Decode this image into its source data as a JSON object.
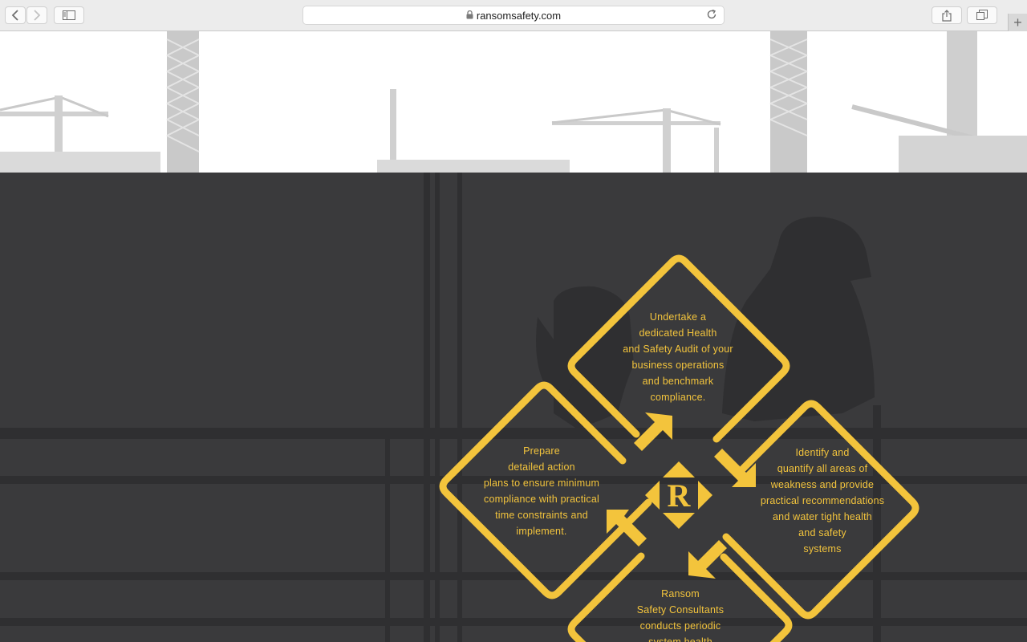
{
  "browser": {
    "url": "ransomsafety.com",
    "icons": {
      "back": "chevron-left-icon",
      "forward": "chevron-right-icon",
      "sidebar": "sidebar-icon",
      "lock": "lock-icon",
      "reload": "reload-icon",
      "share": "share-icon",
      "tabs": "tabs-icon",
      "new_tab": "plus-icon"
    }
  },
  "colors": {
    "accent": "#f3c43c",
    "dark_bg": "#3a3a3c",
    "silhouette": "#2f2f31",
    "hero_silhouette": "#cfcfcf"
  },
  "process": {
    "logo_letter": "R",
    "steps": [
      {
        "text": "Undertake a\ndedicated Health\nand Safety Audit of your\nbusiness operations\nand benchmark\ncompliance."
      },
      {
        "text": "Identify and\nquantify all areas of\nweakness and provide\npractical recommendations\nand water tight health\nand safety\nsystems"
      },
      {
        "text": "Ransom\nSafety Consultants\nconducts periodic\nsystem health"
      },
      {
        "text": "Prepare\ndetailed action\nplans to ensure minimum\ncompliance with practical\ntime constraints and\nimplement."
      }
    ]
  }
}
